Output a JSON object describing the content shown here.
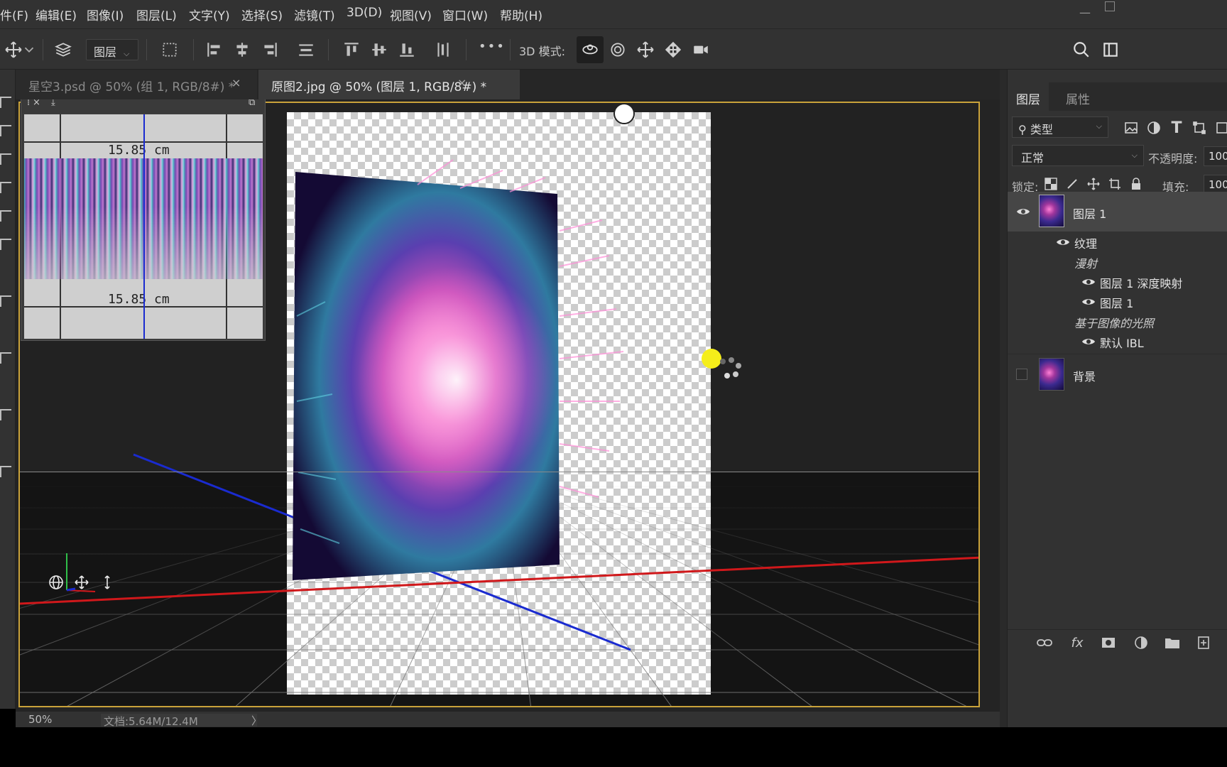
{
  "menu": {
    "items": [
      "件(F)",
      "编辑(E)",
      "图像(I)",
      "图层(L)",
      "文字(Y)",
      "选择(S)",
      "滤镜(T)",
      "3D(D)",
      "视图(V)",
      "窗口(W)",
      "帮助(H)"
    ],
    "minimize": "—"
  },
  "options": {
    "layer_dropdown": "图层",
    "mode3d_label": "3D 模式:",
    "more": "•••"
  },
  "tabs": [
    {
      "label": "星空3.psd @ 50% (组 1, RGB/8#) *",
      "close": "×"
    },
    {
      "label": "原图2.jpg @ 50% (图层 1, RGB/8#) *",
      "close": "×"
    }
  ],
  "secondary_view": {
    "measure_top": "15.85 cm",
    "measure_bottom": "15.85 cm",
    "close": "×"
  },
  "status": {
    "zoom": "50%",
    "doc": "文档:5.64M/12.4M",
    "more": "〉"
  },
  "panel": {
    "tab_layers": "图层",
    "tab_properties": "属性",
    "filter_kind": "类型",
    "blend_mode": "正常",
    "opacity_label": "不透明度:",
    "opacity_value": "100",
    "lock_label": "锁定:",
    "fill_label": "填充:",
    "fill_value": "100",
    "layers": [
      {
        "name": "图层 1",
        "type": "3d-layer",
        "visible": true,
        "selected": true
      },
      {
        "name": "纹理",
        "type": "group",
        "visible": true
      },
      {
        "name": "漫射",
        "type": "sub-heading"
      },
      {
        "name": "图层 1 深度映射",
        "type": "texture",
        "visible": true
      },
      {
        "name": "图层 1",
        "type": "texture",
        "visible": true
      },
      {
        "name": "基于图像的光照",
        "type": "sub-heading"
      },
      {
        "name": "默认 IBL",
        "type": "texture",
        "visible": true
      },
      {
        "name": "背景",
        "type": "layer",
        "visible": false
      }
    ]
  },
  "colors": {
    "frame_border": "#c9a23a",
    "axis_red": "#d0181b",
    "axis_blue": "#1a2bd0",
    "light_dot": "#f5ee1a"
  }
}
